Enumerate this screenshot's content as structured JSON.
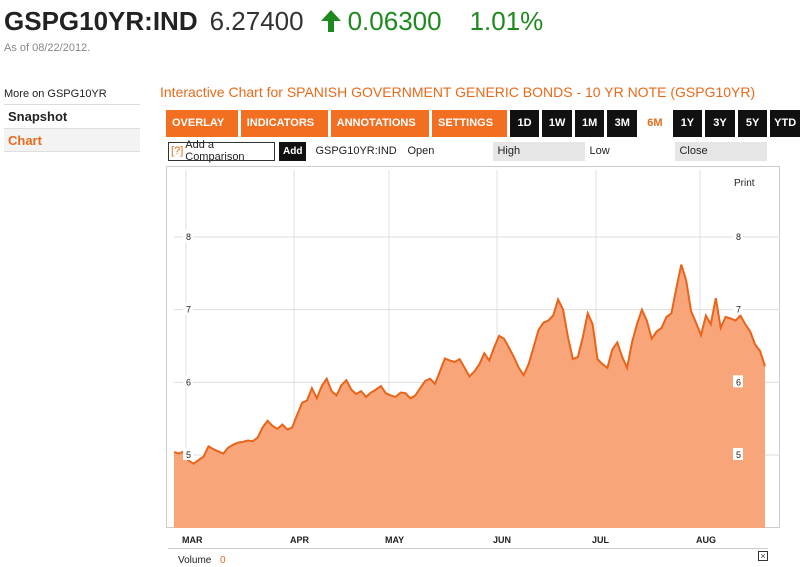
{
  "quote": {
    "ticker": "GSPG10YR:IND",
    "price": "6.27400",
    "change": "0.06300",
    "percent": "1.01%",
    "as_of": "As of 08/22/2012.",
    "direction_icon": "arrow-up-icon",
    "up_color": "#1e8a1e"
  },
  "sidebar": {
    "more_label": "More on GSPG10YR",
    "items": [
      {
        "label": "Snapshot"
      },
      {
        "label": "Chart"
      }
    ]
  },
  "chart_title": "Interactive Chart for SPANISH GOVERNMENT GENERIC BONDS - 10 YR NOTE (GSPG10YR)",
  "toolbar": {
    "menus": [
      "OVERLAY ▾",
      "INDICATORS ▾",
      "ANNOTATIONS ▾",
      "SETTINGS ▾"
    ],
    "ranges": [
      "1D",
      "1W",
      "1M",
      "3M",
      "6M",
      "1Y",
      "3Y",
      "5Y",
      "YTD"
    ],
    "active_range": "6M",
    "accent": "#f26f21"
  },
  "compare": {
    "icon": "?",
    "label": "Add a Comparison",
    "add_label": "Add",
    "symbol": "GSPG10YR:IND",
    "open_label": "Open",
    "high_label": "High",
    "low_label": "Low",
    "close_label": "Close"
  },
  "print_label": "Print",
  "volume": {
    "label": "Volume",
    "value": "0",
    "close_icon": "×"
  },
  "chart_data": {
    "type": "area",
    "title": "",
    "xlabel": "",
    "ylabel": "",
    "ylim": [
      4.0,
      8.5
    ],
    "yticks": [
      5,
      6,
      7,
      8
    ],
    "xticks": [
      "MAR",
      "APR",
      "MAY",
      "JUN",
      "JUL",
      "AUG"
    ],
    "color_fill": "#f9a57a",
    "color_line": "#e8641a",
    "grid": true,
    "series": [
      {
        "values": [
          5.04,
          5.02,
          5.05,
          4.92,
          4.88,
          4.93,
          4.98,
          5.12,
          5.08,
          5.05,
          5.02,
          5.1,
          5.14,
          5.17,
          5.18,
          5.2,
          5.19,
          5.24,
          5.38,
          5.47,
          5.4,
          5.36,
          5.42,
          5.35,
          5.38,
          5.55,
          5.72,
          5.75,
          5.92,
          5.78,
          5.95,
          6.05,
          5.88,
          5.82,
          5.96,
          6.03,
          5.9,
          5.84,
          5.88,
          5.8,
          5.86,
          5.9,
          5.95,
          5.85,
          5.82,
          5.8,
          5.86,
          5.85,
          5.78,
          5.82,
          5.92,
          6.02,
          6.05,
          5.98,
          6.15,
          6.33,
          6.3,
          6.28,
          6.32,
          6.2,
          6.08,
          6.15,
          6.25,
          6.4,
          6.3,
          6.48,
          6.64,
          6.6,
          6.48,
          6.35,
          6.2,
          6.1,
          6.25,
          6.48,
          6.72,
          6.82,
          6.85,
          6.92,
          7.14,
          7.0,
          6.62,
          6.32,
          6.35,
          6.62,
          6.95,
          6.8,
          6.32,
          6.25,
          6.2,
          6.45,
          6.55,
          6.35,
          6.2,
          6.55,
          6.8,
          7.0,
          6.85,
          6.6,
          6.7,
          6.75,
          6.9,
          6.95,
          7.3,
          7.62,
          7.4,
          6.98,
          6.82,
          6.65,
          6.92,
          6.8,
          7.16,
          6.75,
          6.9,
          6.88,
          6.85,
          6.92,
          6.8,
          6.7,
          6.52,
          6.43,
          6.22
        ]
      }
    ]
  }
}
